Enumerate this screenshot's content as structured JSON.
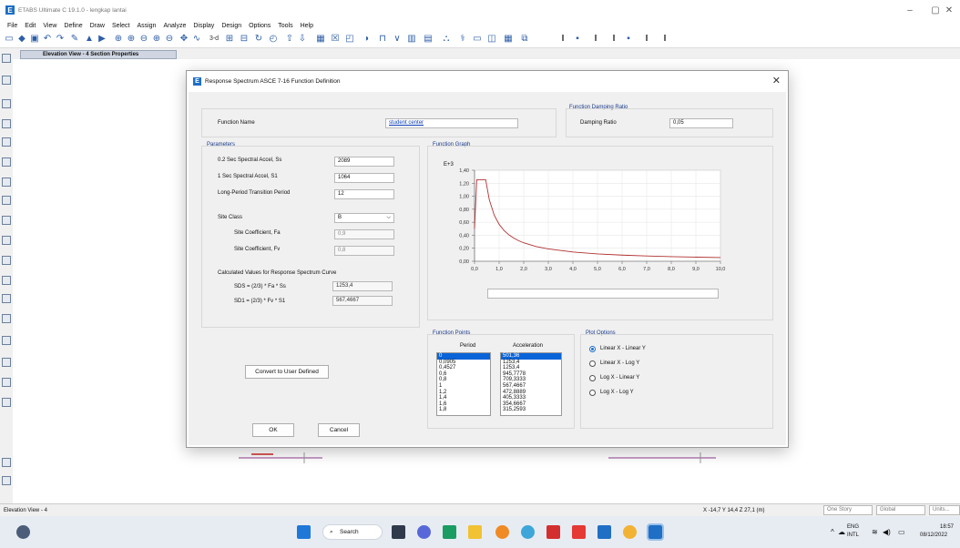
{
  "app": {
    "title": "ETABS Ultimate C 19.1.0 - lengkap lantai",
    "icon": "E"
  },
  "menu": [
    "File",
    "Edit",
    "View",
    "Define",
    "Draw",
    "Select",
    "Assign",
    "Analyze",
    "Display",
    "Design",
    "Options",
    "Tools",
    "Help"
  ],
  "toolbar": {
    "text_items": [
      "3-d",
      "I",
      "I",
      "I",
      "I",
      "I"
    ]
  },
  "doc_tab": "Elevation View - 4  Section Properties",
  "dialog": {
    "title": "Response Spectrum ASCE 7-16 Function Definition",
    "icon": "E",
    "function_name_label": "Function Name",
    "function_name_value": "student center",
    "damping": {
      "group": "Function Damping Ratio",
      "label": "Damping Ratio",
      "value": "0,05"
    },
    "parameters": {
      "group": "Parameters",
      "ss_label": "0.2 Sec Spectral Accel, Ss",
      "ss_value": "2089",
      "s1_label": "1 Sec Spectral Accel, S1",
      "s1_value": "1064",
      "tl_label": "Long-Period Transition Period",
      "tl_value": "12",
      "site_class_label": "Site Class",
      "site_class_value": "B",
      "fa_label": "Site Coefficient, Fa",
      "fa_value": "0,9",
      "fv_label": "Site Coefficient, Fv",
      "fv_value": "0,8",
      "calc_label": "Calculated Values for Response Spectrum Curve",
      "sds_label": "SDS = (2/3) * Fa * Ss",
      "sds_value": "1253,4",
      "sd1_label": "SD1 = (2/3) * Fv * S1",
      "sd1_value": "567,4667"
    },
    "convert_button": "Convert to User Defined",
    "ok_button": "OK",
    "cancel_button": "Cancel",
    "graph": {
      "group": "Function Graph",
      "scale_label": "E+3",
      "y_ticks": [
        "1,40",
        "1,20",
        "1,00",
        "0,80",
        "0,60",
        "0,40",
        "0,20",
        "0,00"
      ],
      "x_ticks": [
        "0,0",
        "1,0",
        "2,0",
        "3,0",
        "4,0",
        "5,0",
        "6,0",
        "7,0",
        "8,0",
        "9,0",
        "10,0"
      ]
    },
    "points": {
      "group": "Function Points",
      "period_header": "Period",
      "accel_header": "Acceleration",
      "periods": [
        "0",
        "0,0905",
        "0,4527",
        "0,6",
        "0,8",
        "1",
        "1,2",
        "1,4",
        "1,6",
        "1,8"
      ],
      "accels": [
        "501,36",
        "1253,4",
        "1253,4",
        "945,7778",
        "709,3333",
        "567,4667",
        "472,8889",
        "405,3333",
        "354,6667",
        "315,2593"
      ]
    },
    "plot_options": {
      "group": "Plot Options",
      "options": [
        "Linear X - Linear Y",
        "Linear X - Log Y",
        "Log X - Linear Y",
        "Log X - Log Y"
      ],
      "selected": 0
    }
  },
  "chart_data": {
    "type": "line",
    "title": "",
    "xlabel": "",
    "ylabel": "",
    "y_scale_note": "E+3",
    "xlim": [
      0,
      10
    ],
    "ylim": [
      0,
      1.4
    ],
    "grid": true,
    "series": [
      {
        "x": [
          0,
          0.0905,
          0.4527,
          0.6,
          0.8,
          1.0,
          1.2,
          1.4,
          1.6,
          1.8,
          2.0,
          2.5,
          3.0,
          4.0,
          5.0,
          6.0,
          7.0,
          8.0,
          9.0,
          10.0
        ],
        "y": [
          0.50136,
          1.2534,
          1.2534,
          0.9458,
          0.7093,
          0.5675,
          0.4729,
          0.4053,
          0.3547,
          0.3153,
          0.2837,
          0.227,
          0.1892,
          0.1419,
          0.1135,
          0.0946,
          0.0811,
          0.0709,
          0.0631,
          0.0567
        ]
      }
    ]
  },
  "status": {
    "left": "Elevation View - 4",
    "coords": "X -14,7  Y 14,4  Z 27,1 (m)",
    "story": "One Story",
    "global": "Global",
    "units": "Units..."
  },
  "taskbar": {
    "search": "Search",
    "lang1": "ENG",
    "lang2": "INTL",
    "time": "18:57",
    "date": "08/12/2022"
  },
  "colors": {
    "accent": "#1e6fc5",
    "curve": "#b03030",
    "selection": "#0a64d8"
  }
}
